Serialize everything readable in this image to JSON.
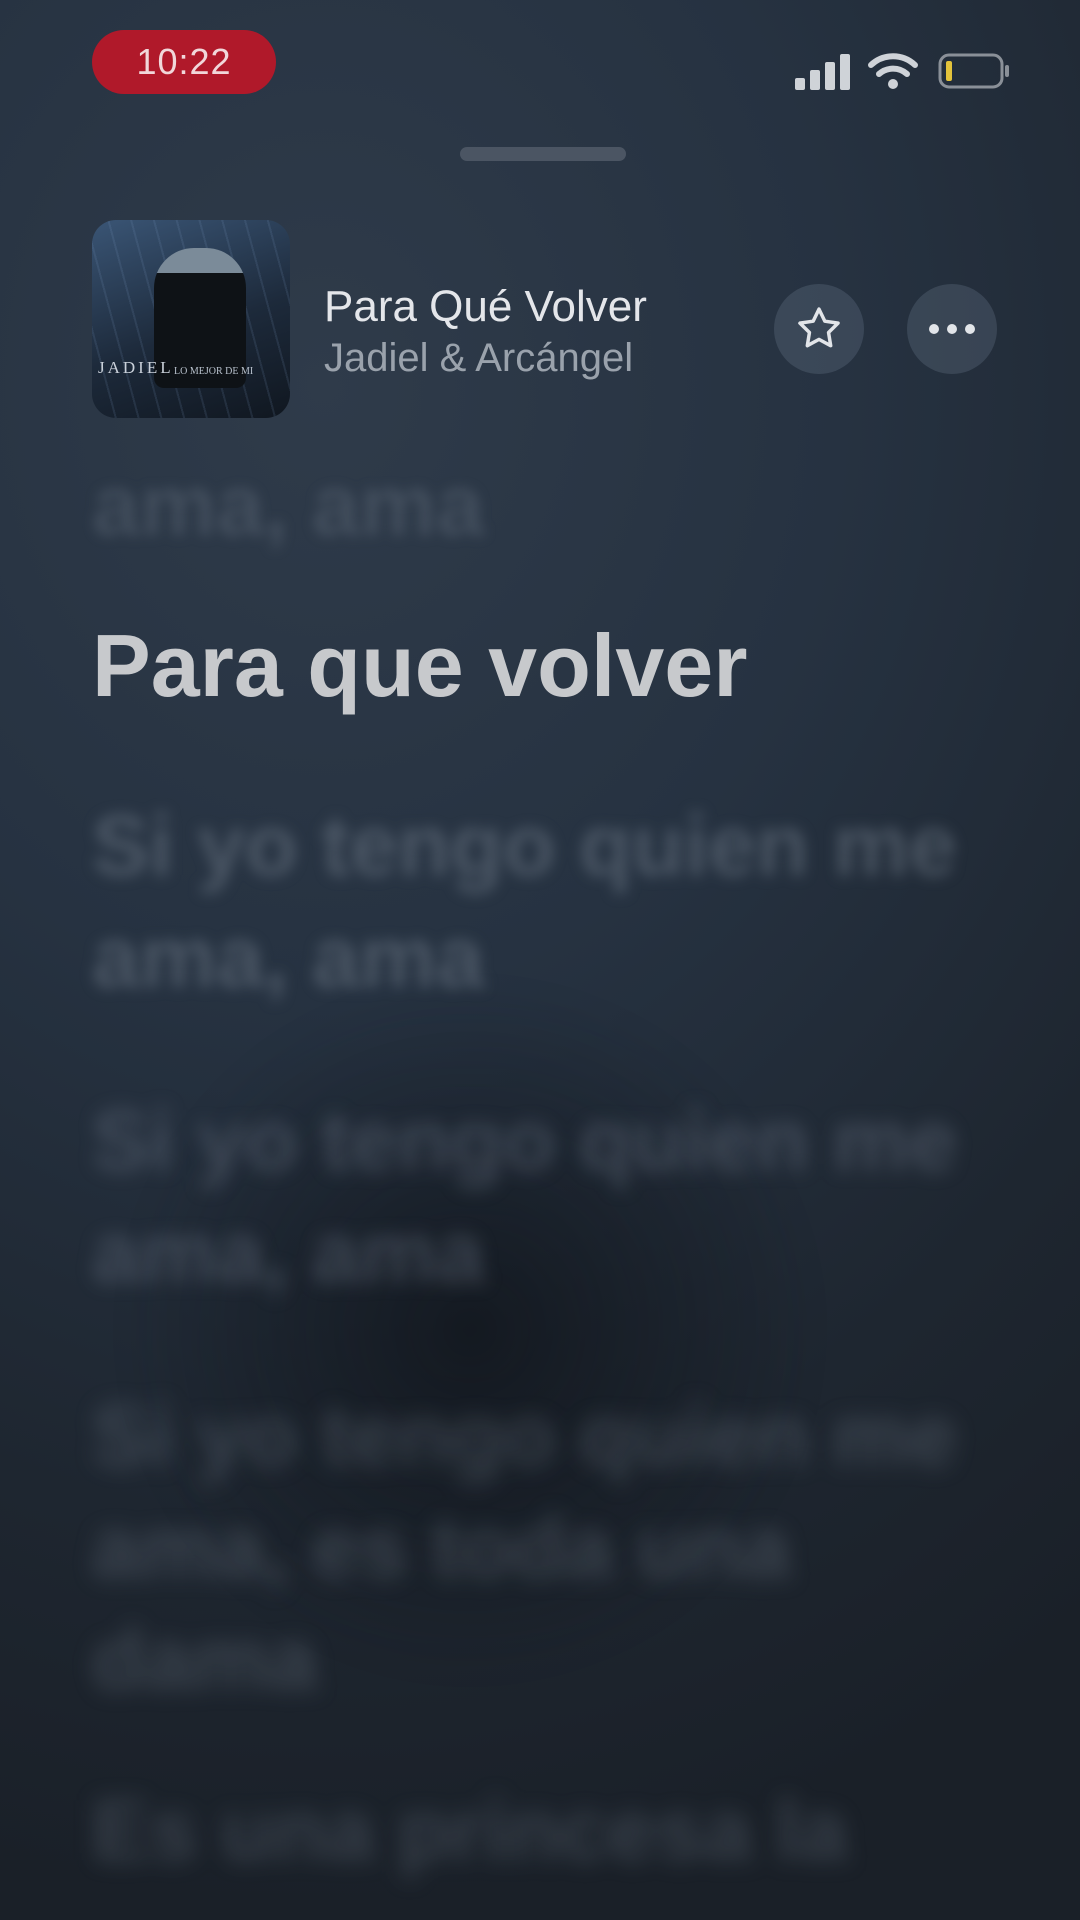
{
  "status_bar": {
    "time": "10:22",
    "time_pill_color": "#b0192a",
    "icons": [
      "signal-icon",
      "wifi-icon",
      "battery-icon"
    ]
  },
  "now_playing": {
    "title": "Para Qué Volver",
    "artist": "Jadiel & Arcángel",
    "artwork": {
      "text": "JADIEL",
      "subtext": "LO MEJOR DE MI"
    },
    "buttons": {
      "favorite_icon": "star-icon",
      "more_icon": "ellipsis-icon"
    }
  },
  "lyrics": {
    "previous": "ama, ama",
    "current": "Para que volver",
    "upcoming": [
      "Si yo tengo quien me ama, ama",
      "Si yo tengo quien me ama, ama",
      "Si yo tengo quien me ama, es toda una dama",
      "Es una princesa la"
    ]
  }
}
